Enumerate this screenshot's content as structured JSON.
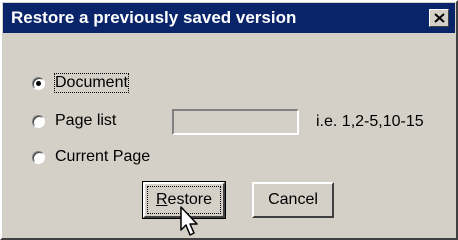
{
  "window": {
    "title": "Restore a previously saved version",
    "close_icon": "close-icon"
  },
  "options": [
    {
      "label": "Document",
      "checked": true
    },
    {
      "label": "Page list",
      "checked": false
    },
    {
      "label": "Current Page",
      "checked": false
    }
  ],
  "page_list_field": {
    "value": "",
    "hint": "i.e. 1,2-5,10-15"
  },
  "buttons": {
    "restore": {
      "mnemonic": "R",
      "rest": "estore"
    },
    "cancel": "Cancel"
  },
  "colors": {
    "titlebar": "#0a246a",
    "face": "#d4d0c8"
  }
}
